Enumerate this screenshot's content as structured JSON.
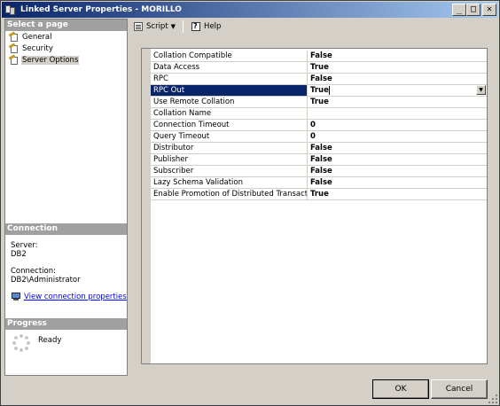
{
  "window": {
    "title": "Linked Server Properties - MORILLO",
    "controls": [
      "_",
      "□",
      "✕"
    ]
  },
  "select_page": {
    "heading": "Select a page",
    "items": [
      {
        "label": "General",
        "icon": "wrench-page-icon"
      },
      {
        "label": "Security",
        "icon": "wrench-page-icon"
      },
      {
        "label": "Server Options",
        "icon": "wrench-page-icon",
        "selected": true
      }
    ]
  },
  "connection": {
    "heading": "Connection",
    "server_label": "Server:",
    "server_value": "DB2",
    "connection_label": "Connection:",
    "connection_value": "DB2\\Administrator",
    "view_link": "View connection properties"
  },
  "progress": {
    "heading": "Progress",
    "status": "Ready"
  },
  "toolbar": {
    "script_label": "Script",
    "help_label": "Help"
  },
  "properties": [
    {
      "name": "Collation Compatible",
      "value": "False"
    },
    {
      "name": "Data Access",
      "value": "True"
    },
    {
      "name": "RPC",
      "value": "False"
    },
    {
      "name": "RPC Out",
      "value": "True",
      "selected": true
    },
    {
      "name": "Use Remote Collation",
      "value": "True"
    },
    {
      "name": "Collation Name",
      "value": ""
    },
    {
      "name": "Connection Timeout",
      "value": "0"
    },
    {
      "name": "Query Timeout",
      "value": "0"
    },
    {
      "name": "Distributor",
      "value": "False"
    },
    {
      "name": "Publisher",
      "value": "False"
    },
    {
      "name": "Subscriber",
      "value": "False"
    },
    {
      "name": "Lazy Schema Validation",
      "value": "False"
    },
    {
      "name": "Enable Promotion of Distributed Transactions for RPC",
      "value": "True"
    }
  ],
  "buttons": {
    "ok": "OK",
    "cancel": "Cancel"
  },
  "colors": {
    "title_start": "#0a246a",
    "title_end": "#a6caf0",
    "selection": "#0a246a",
    "section_head": "#a0a0a0",
    "link": "#0000ff"
  }
}
